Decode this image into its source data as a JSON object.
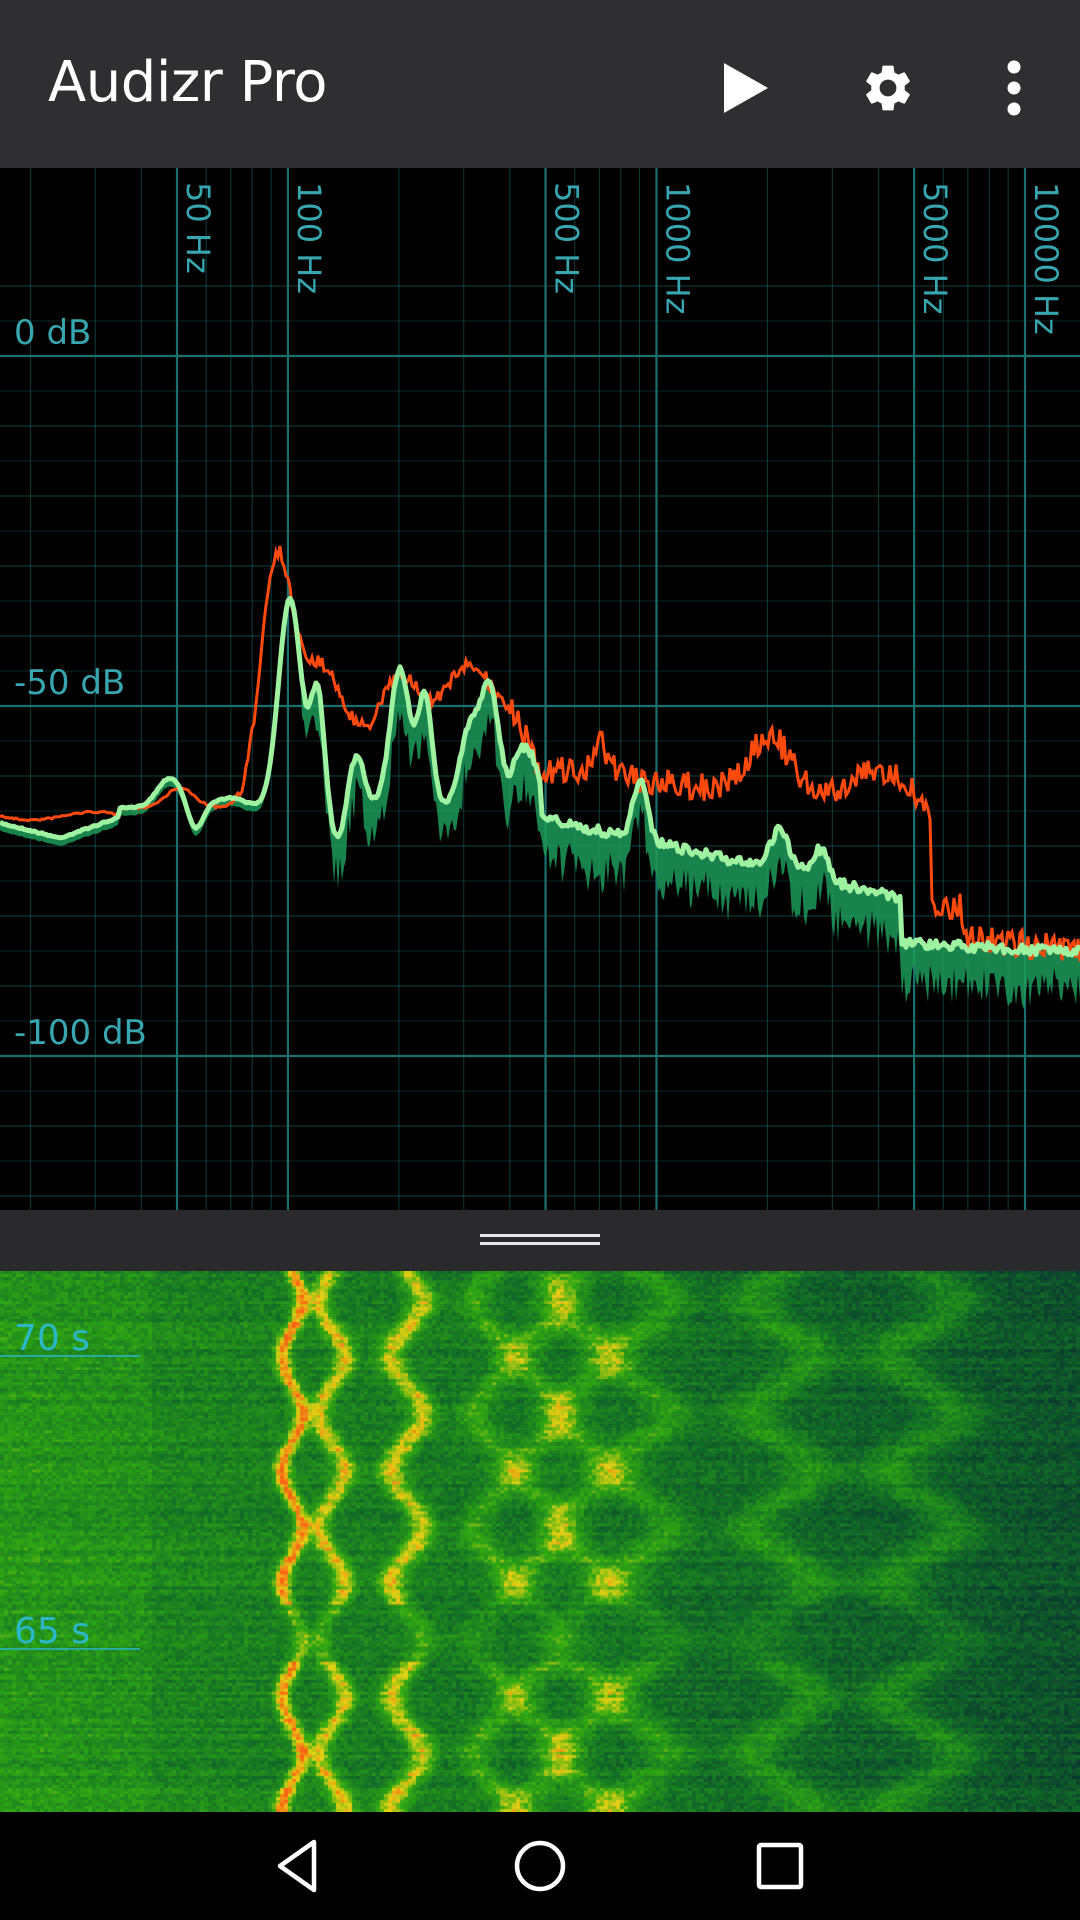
{
  "app": {
    "title": "Audizr Pro",
    "play_icon": "play-icon",
    "settings_icon": "gear-icon",
    "menu_icon": "more-vertical-icon"
  },
  "spectrum": {
    "freq_labels": [
      "50 Hz",
      "100 Hz",
      "500 Hz",
      "1000 Hz",
      "5000 Hz",
      "10000 Hz"
    ],
    "freq_values": [
      50,
      100,
      500,
      1000,
      5000,
      10000
    ],
    "db_labels": [
      "0 dB",
      "-50 dB",
      "-100 dB"
    ],
    "db_values": [
      0,
      -50,
      -100
    ],
    "colors": {
      "grid": "#1b6f6f",
      "label": "#38a6b0",
      "peak_line": "#ff4a0e",
      "current_line": "#9ff3a0",
      "fill": "#1d9a5a"
    }
  },
  "spectrogram": {
    "time_labels": [
      "70 s",
      "65 s"
    ],
    "label_color": "#2ab8c8"
  },
  "navbar": {
    "back_icon": "back-icon",
    "home_icon": "home-icon",
    "recents_icon": "recents-icon"
  }
}
